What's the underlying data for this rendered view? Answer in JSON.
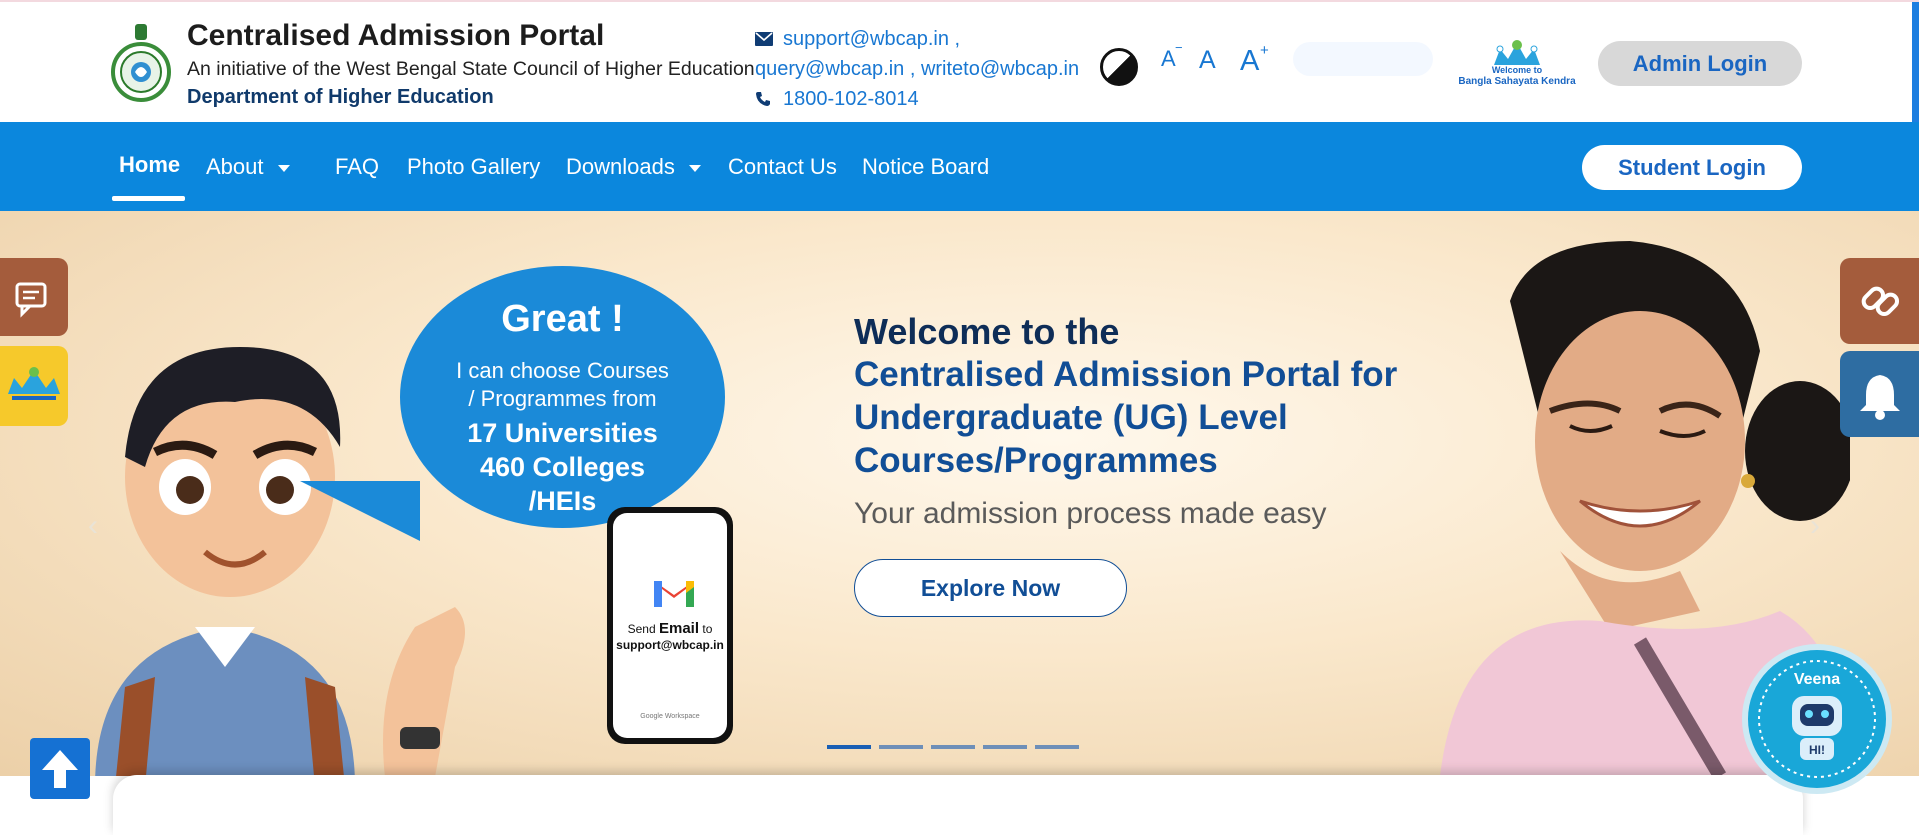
{
  "header": {
    "title": "Centralised Admission Portal",
    "subtitle": "An initiative of the West Bengal State Council of Higher Education",
    "department": "Department of Higher Education",
    "contact": {
      "email_line1": "support@wbcap.in ,",
      "email_line2": "query@wbcap.in , writeto@wbcap.in",
      "phone": "1800-102-8014"
    },
    "font_controls": {
      "decrease": "A",
      "default": "A",
      "increase": "A"
    },
    "bsk_logo_text": {
      "line1": "Welcome to",
      "line2": "Bangla Sahayata Kendra"
    },
    "admin_login": "Admin Login"
  },
  "nav": {
    "items": [
      {
        "label": "Home",
        "active": true
      },
      {
        "label": "About",
        "dropdown": true
      },
      {
        "label": "FAQ"
      },
      {
        "label": "Photo Gallery"
      },
      {
        "label": "Downloads",
        "dropdown": true
      },
      {
        "label": "Contact Us"
      },
      {
        "label": "Notice Board"
      }
    ],
    "student_login": "Student Login"
  },
  "hero": {
    "welcome": "Welcome to the",
    "headline": "Centralised Admission Portal for Undergraduate (UG) Level Courses/Programmes",
    "tagline": "Your admission process made easy",
    "cta": "Explore Now",
    "slide_count": 5,
    "active_slide": 1,
    "bubble": {
      "title": "Great !",
      "line1": "I can choose Courses",
      "line2": "/ Programmes from",
      "line3": "17 Universities",
      "line4": "460 Colleges",
      "line5": "/HEIs"
    },
    "phone": {
      "send_prefix": "Send",
      "send_bold": "Email",
      "send_suffix": "to",
      "address": "support@wbcap.in",
      "footer": "Google Workspace"
    },
    "chatbot_label": "Veena"
  },
  "colors": {
    "nav_bg": "#0b87dd",
    "brand_blue": "#1a66c2",
    "side_brown": "#a45c3c",
    "side_blue": "#2e6da2",
    "bsk_yellow": "#f6c92b"
  },
  "icons": {
    "email": "envelope-icon",
    "phone": "phone-icon",
    "contrast": "contrast-icon",
    "chat": "chat-icon",
    "link": "link-icon",
    "bell": "bell-icon",
    "scroll_top": "arrow-up-icon"
  }
}
